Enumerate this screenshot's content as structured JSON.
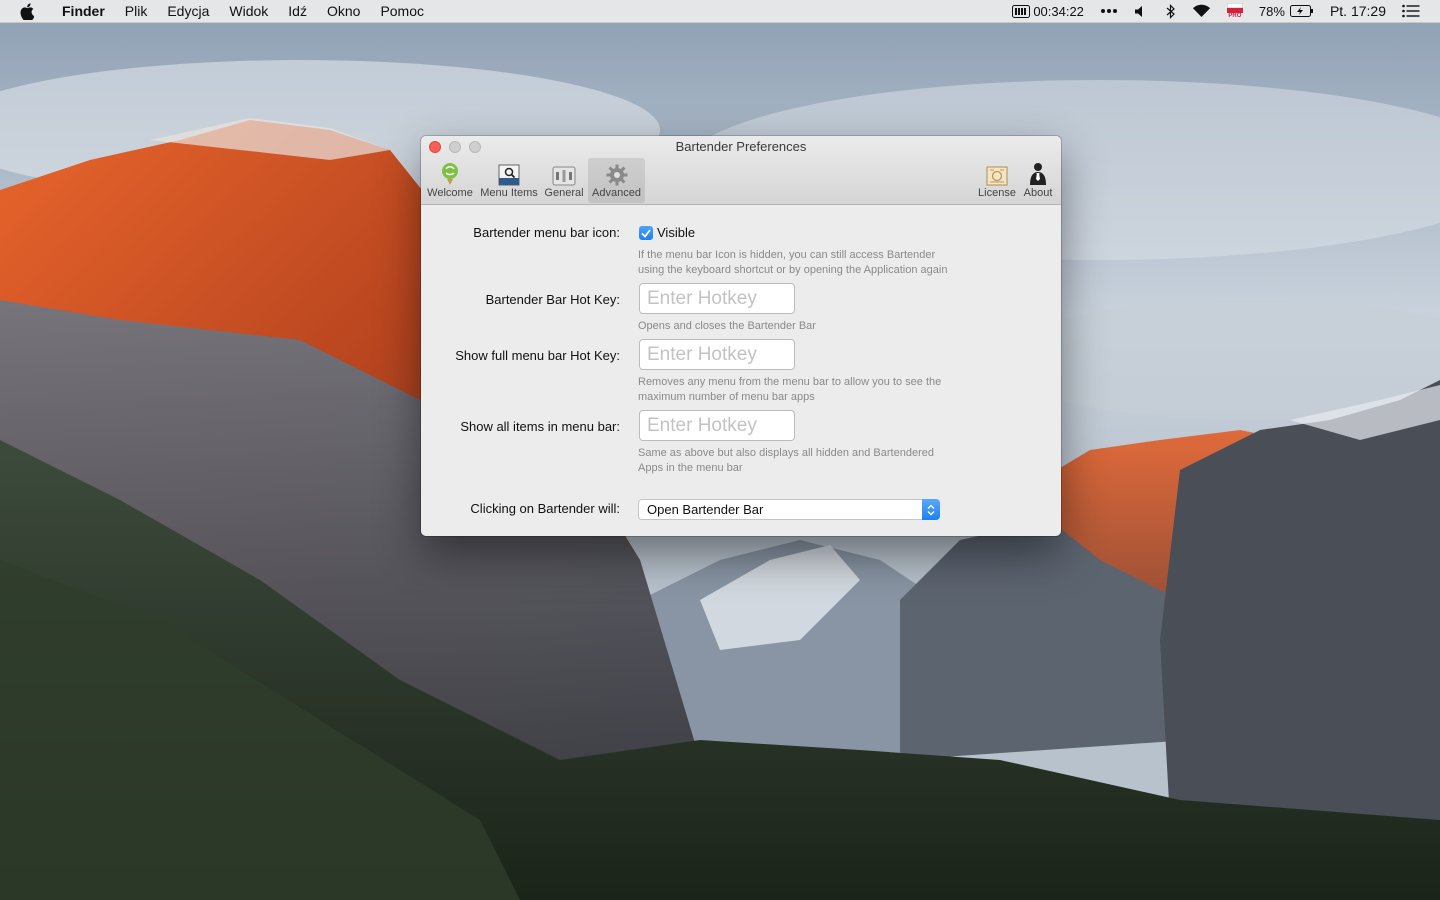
{
  "menubar": {
    "app_name": "Finder",
    "menus": [
      "Plik",
      "Edycja",
      "Widok",
      "Idź",
      "Okno",
      "Pomoc"
    ],
    "timer": "00:34:22",
    "battery_percent": "78%",
    "clock": "Pt. 17:29",
    "flag_badge": "PRO"
  },
  "window": {
    "title": "Bartender Preferences",
    "toolbar": {
      "welcome": "Welcome",
      "menu_items": "Menu Items",
      "general": "General",
      "advanced": "Advanced",
      "license": "License",
      "about": "About",
      "selected": "Advanced"
    },
    "settings": {
      "menu_bar_icon_label": "Bartender menu bar icon:",
      "visible_label": "Visible",
      "visible_checked": true,
      "visible_hint_1": "If the menu bar Icon is hidden, you can still access Bartender",
      "visible_hint_2": "using the keyboard shortcut or by opening the Application again",
      "bar_hotkey_label": "Bartender Bar Hot Key:",
      "hotkey_placeholder": "Enter Hotkey",
      "bar_hotkey_hint": "Opens and closes the Bartender Bar",
      "full_menu_label": "Show full menu bar Hot Key:",
      "full_menu_hint_1": "Removes any menu from the menu bar to allow you to see the",
      "full_menu_hint_2": "maximum number of menu bar apps",
      "all_items_label": "Show all items in menu bar:",
      "all_items_hint_1": "Same as above but also displays all hidden and Bartendered",
      "all_items_hint_2": "Apps in the menu bar",
      "clicking_label": "Clicking on Bartender will:",
      "clicking_value": "Open Bartender Bar"
    }
  },
  "colors": {
    "accent": "#1f7ff0",
    "close_button": "#fc5f57",
    "hint_text": "#8a8a8a"
  },
  "icons": [
    "apple-icon",
    "timer-icon",
    "more-icon",
    "volume-icon",
    "bluetooth-icon",
    "wifi-icon",
    "flag-icon",
    "battery-icon",
    "control-center-icon",
    "welcome-icon",
    "menu-items-icon",
    "general-icon",
    "advanced-gear-icon",
    "license-icon",
    "about-icon"
  ]
}
